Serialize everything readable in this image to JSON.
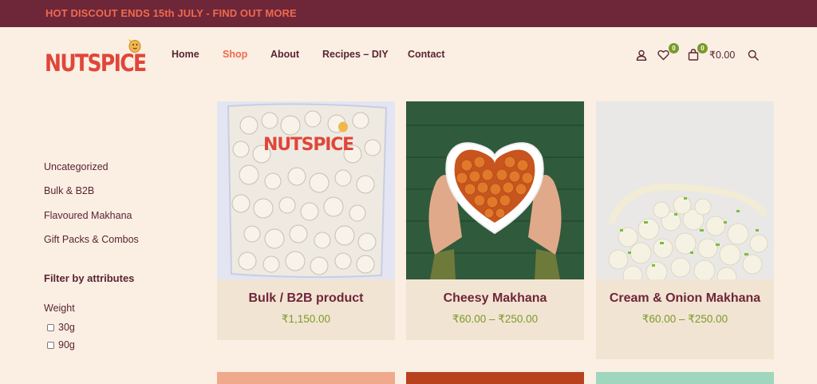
{
  "promo": {
    "text": "HOT DISCOUT ENDS 15th JULY - FIND OUT MORE"
  },
  "brand": {
    "logo_text": "NUTSPICE"
  },
  "nav": {
    "items": [
      {
        "label": "Home"
      },
      {
        "label": "Shop",
        "active": true
      },
      {
        "label": "About"
      },
      {
        "label": "Recipes – DIY"
      },
      {
        "label": "Contact"
      }
    ]
  },
  "header_actions": {
    "wishlist_count": "0",
    "cart_count": "0",
    "cart_total": "₹0.00",
    "icons": [
      "user-icon",
      "heart-icon",
      "bag-icon",
      "search-icon"
    ]
  },
  "sidebar": {
    "categories": [
      {
        "label": "Uncategorized"
      },
      {
        "label": "Bulk & B2B"
      },
      {
        "label": "Flavoured Makhana"
      },
      {
        "label": "Gift Packs & Combos"
      }
    ],
    "filter_title": "Filter by attributes",
    "weight_label": "Weight",
    "weight_options": [
      {
        "label": "30g",
        "checked": false
      },
      {
        "label": "90g",
        "checked": false
      }
    ]
  },
  "products": [
    {
      "title": "Bulk / B2B product",
      "price": "₹1,150.00"
    },
    {
      "title": "Cheesy Makhana",
      "price": "₹60.00 – ₹250.00"
    },
    {
      "title": "Cream & Onion Makhana",
      "price": "₹60.00 – ₹250.00"
    }
  ],
  "colors": {
    "promo_bg": "#6e2639",
    "promo_text": "#ee6a4d",
    "page_bg": "#faefe2",
    "text_primary": "#5a2434",
    "accent": "#ee6a4d",
    "price": "#7a9a2c",
    "card_bg": "#f2e4d2"
  }
}
